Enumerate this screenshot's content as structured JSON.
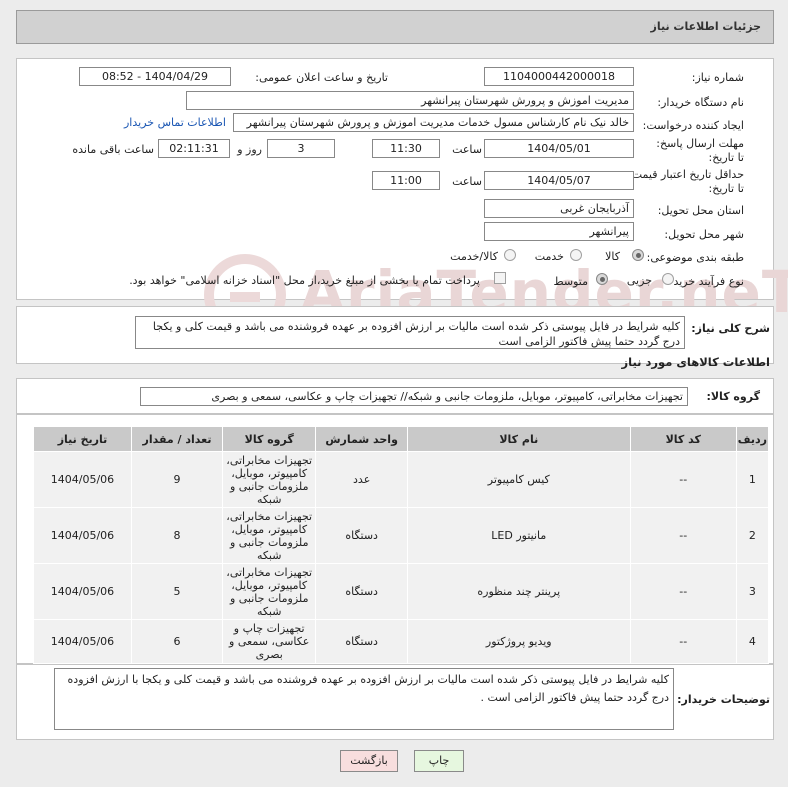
{
  "header": {
    "title": "جزئیات اطلاعات نیاز"
  },
  "fields": {
    "need_number_label": "شماره نیاز:",
    "need_number": "1104000442000018",
    "announce_label": "تاریخ و ساعت اعلان عمومی:",
    "announce_value": "1404/04/29 - 08:52",
    "buyer_org_label": "نام دستگاه خریدار:",
    "buyer_org": "مدیریت اموزش و پرورش شهرستان پیرانشهر",
    "creator_label": "ایجاد کننده درخواست:",
    "creator": "خالد نیک نام کارشناس مسول خدمات مدیریت اموزش و پرورش شهرستان پیرانشهر",
    "contact_link": "اطلاعات تماس خریدار",
    "deadline_label": "مهلت ارسال پاسخ: تا تاریخ:",
    "deadline_date": "1404/05/01",
    "time_label": "ساعت",
    "deadline_time": "11:30",
    "days_value": "3",
    "days_label": "روز و",
    "remaining_time": "02:11:31",
    "remaining_label": "ساعت باقی مانده",
    "validity_label": "حداقل تاریخ اعتبار قیمت: تا تاریخ:",
    "validity_date": "1404/05/07",
    "validity_time": "11:00",
    "province_label": "استان محل تحویل:",
    "province": "آذربایجان غربی",
    "city_label": "شهر محل تحویل:",
    "city": "پیرانشهر",
    "category_label": "طبقه بندی موضوعی:",
    "category_options": [
      "کالا",
      "خدمت",
      "کالا/خدمت"
    ],
    "process_label": "نوع فرآیند خرید :",
    "process_options": [
      "جزیی",
      "متوسط"
    ],
    "payment_note": "پرداخت تمام یا بخشی از مبلغ خرید،از محل \"اسناد خزانه اسلامی\" خواهد بود."
  },
  "description": {
    "label": "شرح کلی نیاز:",
    "text": "کلیه شرایط در فایل پیوستی ذکر شده است مالیات بر ارزش افزوده بر عهده فروشنده می باشد و قیمت کلی و یکجا درج گردد حتما پیش فاکتور الزامی است"
  },
  "goods": {
    "section_title": "اطلاعات کالاهای مورد نیاز",
    "group_label": "گروه کالا:",
    "group_value": "تجهیزات مخابراتی، کامپیوتر، موبایل، ملزومات جانبی و شبکه// تجهیزات چاپ و عکاسی، سمعی و بصری",
    "columns": [
      "ردیف",
      "کد کالا",
      "نام کالا",
      "واحد شمارش",
      "گروه کالا",
      "تعداد / مقدار",
      "تاریخ نیاز"
    ],
    "rows": [
      {
        "row": "1",
        "code": "--",
        "name": "کیس کامپیوتر",
        "unit": "عدد",
        "group": "تجهیزات مخابراتی، کامپیوتر، موبایل، ملزومات جانبی و شبکه",
        "qty": "9",
        "date": "1404/05/06"
      },
      {
        "row": "2",
        "code": "--",
        "name": "مانیتور LED",
        "unit": "دستگاه",
        "group": "تجهیزات مخابراتی، کامپیوتر، موبایل، ملزومات جانبی و شبکه",
        "qty": "8",
        "date": "1404/05/06"
      },
      {
        "row": "3",
        "code": "--",
        "name": "پرینتر چند منظوره",
        "unit": "دستگاه",
        "group": "تجهیزات مخابراتی، کامپیوتر، موبایل، ملزومات جانبی و شبکه",
        "qty": "5",
        "date": "1404/05/06"
      },
      {
        "row": "4",
        "code": "--",
        "name": "ویدیو پروژکتور",
        "unit": "دستگاه",
        "group": "تجهیزات چاپ و عکاسی، سمعی و بصری",
        "qty": "6",
        "date": "1404/05/06"
      }
    ]
  },
  "buyer_notes": {
    "label": "توضیحات خریدار:",
    "text": "کلیه شرایط در فایل پیوستی ذکر شده است مالیات بر ارزش افزوده بر عهده فروشنده می باشد و قیمت کلی و یکجا  با ارزش افزوده درج گردد حتما پیش فاکتور الزامی است ."
  },
  "buttons": {
    "print": "چاپ",
    "back": "بازگشت"
  },
  "watermark": "AriaTender.neT",
  "colors": {
    "header_bg": "#d1d1d1",
    "table_header": "#c9c9c9",
    "link": "#1a56b3",
    "back_button": "#f8dede",
    "print_button": "#e6f7df"
  }
}
